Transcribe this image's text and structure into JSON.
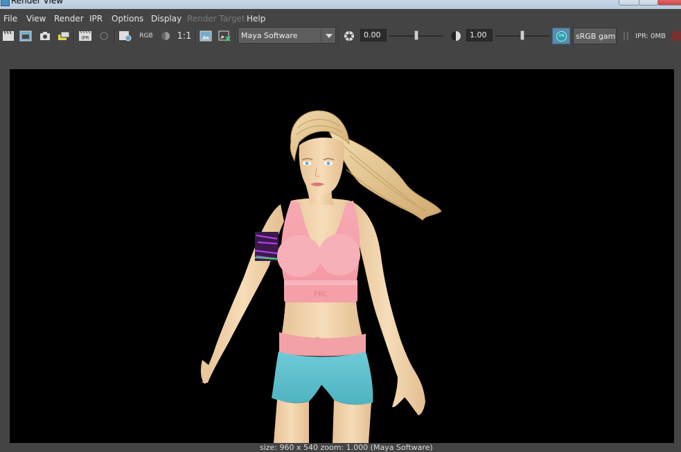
{
  "window": {
    "title": "Render View"
  },
  "menu": [
    {
      "label": "File",
      "enabled": true
    },
    {
      "label": "View",
      "enabled": true
    },
    {
      "label": "Render",
      "enabled": true
    },
    {
      "label": "IPR",
      "enabled": true
    },
    {
      "label": "Options",
      "enabled": true
    },
    {
      "label": "Display",
      "enabled": true
    },
    {
      "label": "Render Target",
      "enabled": false
    },
    {
      "label": "Help",
      "enabled": true
    }
  ],
  "toolbar": {
    "rgb_label": "RGB",
    "one_to_one_label": "1:1",
    "renderer": "Maya Software",
    "exposure_value": "0.00",
    "gamma_value": "1.00",
    "color_mgmt_toggle": "ON",
    "color_space": "sRGB gamma",
    "ipr_memory": "IPR: 0MB"
  },
  "status": {
    "text": "size: 960 x 540  zoom: 1.000        (Maya Software)"
  },
  "colors": {
    "background": "#444444",
    "viewport": "#000000",
    "accent_on": "#5a8cb0",
    "top_pink": "#f5a3ad",
    "shorts_cyan": "#5bc0cf",
    "hair_blonde": "#e7cf9c",
    "skin": "#f0d2a8"
  }
}
